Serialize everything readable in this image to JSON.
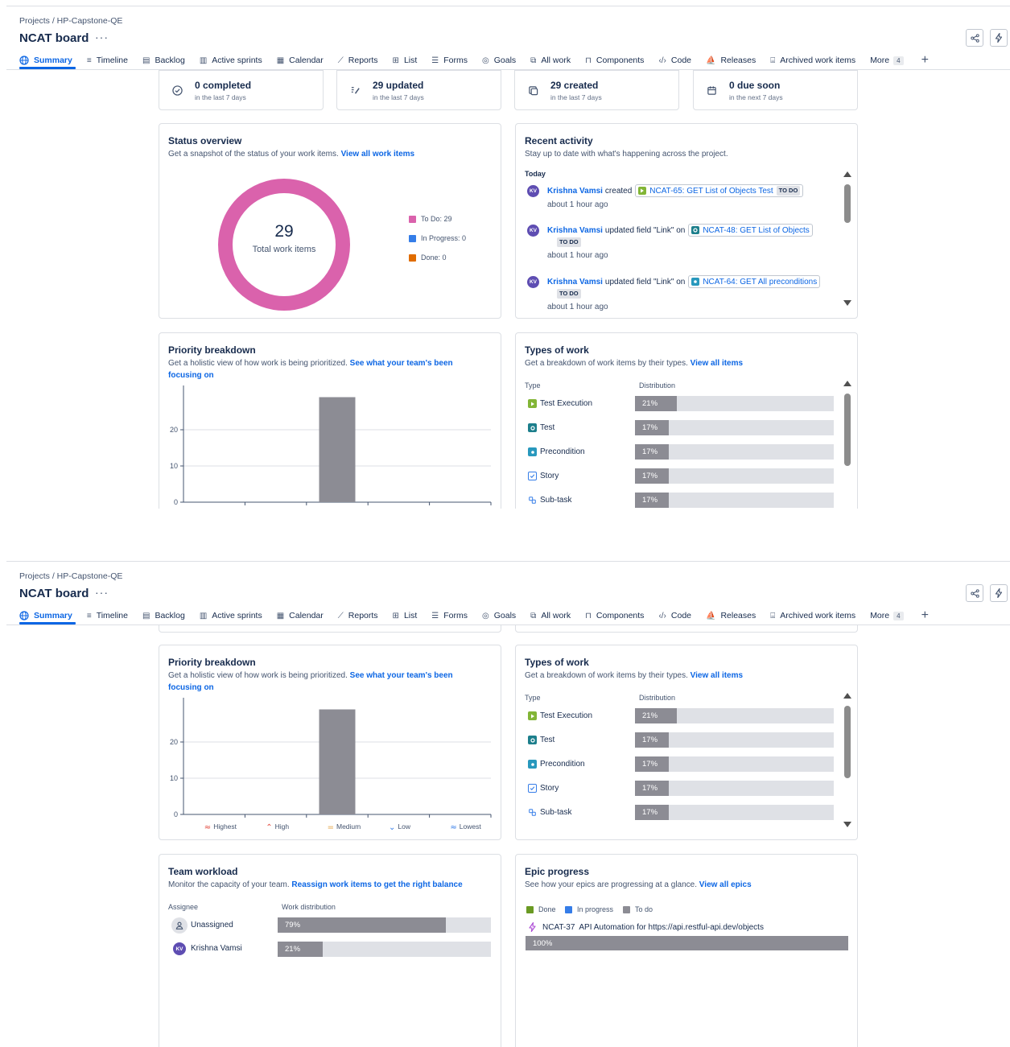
{
  "header": {
    "breadcrumb": "Projects  /  HP-Capstone-QE",
    "title": "NCAT board",
    "more": "···"
  },
  "tabs": [
    {
      "label": "Summary",
      "icon": "globe-icon"
    },
    {
      "label": "Timeline",
      "icon": "timeline-icon"
    },
    {
      "label": "Backlog",
      "icon": "backlog-icon"
    },
    {
      "label": "Active sprints",
      "icon": "board-icon"
    },
    {
      "label": "Calendar",
      "icon": "calendar-icon"
    },
    {
      "label": "Reports",
      "icon": "chart-icon"
    },
    {
      "label": "List",
      "icon": "list-icon"
    },
    {
      "label": "Forms",
      "icon": "forms-icon"
    },
    {
      "label": "Goals",
      "icon": "target-icon"
    },
    {
      "label": "All work",
      "icon": "stack-icon"
    },
    {
      "label": "Components",
      "icon": "components-icon"
    },
    {
      "label": "Code",
      "icon": "code-icon"
    },
    {
      "label": "Releases",
      "icon": "ship-icon"
    },
    {
      "label": "Archived work items",
      "icon": "archive-icon"
    }
  ],
  "more_tab": {
    "label": "More",
    "count": "4"
  },
  "stats": [
    {
      "value": "0 completed",
      "sub": "in the last 7 days",
      "icon": "check-circle-icon"
    },
    {
      "value": "29 updated",
      "sub": "in the last 7 days",
      "icon": "edit-icon"
    },
    {
      "value": "29 created",
      "sub": "in the last 7 days",
      "icon": "create-icon"
    },
    {
      "value": "0 due soon",
      "sub": "in the next 7 days",
      "icon": "calendar-icon"
    }
  ],
  "status_overview": {
    "title": "Status overview",
    "desc": "Get a snapshot of the status of your work items.",
    "link": "View all work items",
    "total": "29",
    "total_label": "Total work items",
    "legend": [
      {
        "label": "To Do: 29",
        "color": "#da62ac",
        "value": 29
      },
      {
        "label": "In Progress: 0",
        "color": "#357de8",
        "value": 0
      },
      {
        "label": "Done: 0",
        "color": "#e06c00",
        "value": 0
      }
    ]
  },
  "recent_activity": {
    "title": "Recent activity",
    "desc": "Stay up to date with what's happening across the project.",
    "day": "Today",
    "items": [
      {
        "avatar": "KV",
        "name": "Krishna Vamsi",
        "action": "created",
        "issue": "NCAT-65: GET List of Objects Test",
        "status": "TO DO",
        "time": "about 1 hour ago",
        "icon_color": "#82b536"
      },
      {
        "avatar": "KV",
        "name": "Krishna Vamsi",
        "action": "updated field \"Link\" on",
        "issue": "NCAT-48: GET List of Objects",
        "status": "TO DO",
        "time": "about 1 hour ago",
        "icon_color": "#1d7f8c"
      },
      {
        "avatar": "KV",
        "name": "Krishna Vamsi",
        "action": "updated field \"Link\" on",
        "issue": "NCAT-64: GET All preconditions",
        "status": "TO DO",
        "time": "about 1 hour ago",
        "icon_color": "#2898bd"
      }
    ]
  },
  "priority": {
    "title": "Priority breakdown",
    "desc": "Get a holistic view of how work is being prioritized.",
    "link1": "See what your team's been",
    "link2": "focusing on"
  },
  "types": {
    "title": "Types of work",
    "desc": "Get a breakdown of work items by their types.",
    "link": "View all items",
    "col_type": "Type",
    "col_dist": "Distribution",
    "rows": [
      {
        "label": "Test Execution",
        "pct": "21%",
        "value": 21,
        "icon": "test-execution-icon",
        "color": "#82b536"
      },
      {
        "label": "Test",
        "pct": "17%",
        "value": 17,
        "icon": "test-icon",
        "color": "#1d7f8c"
      },
      {
        "label": "Precondition",
        "pct": "17%",
        "value": 17,
        "icon": "precondition-icon",
        "color": "#2898bd"
      },
      {
        "label": "Story",
        "pct": "17%",
        "value": 17,
        "icon": "story-icon",
        "color": "#357de8"
      },
      {
        "label": "Sub-task",
        "pct": "17%",
        "value": 17,
        "icon": "subtask-icon",
        "color": "#357de8"
      }
    ]
  },
  "team": {
    "title": "Team workload",
    "desc": "Monitor the capacity of your team.",
    "link": "Reassign work items to get the right balance",
    "col_assignee": "Assignee",
    "col_dist": "Work distribution",
    "rows": [
      {
        "name": "Unassigned",
        "pct": "79%",
        "value": 79,
        "avatar": ""
      },
      {
        "name": "Krishna Vamsi",
        "pct": "21%",
        "value": 21,
        "avatar": "KV"
      }
    ]
  },
  "epic": {
    "title": "Epic progress",
    "desc": "See how your epics are progressing at a glance.",
    "link": "View all epics",
    "legend": [
      {
        "label": "Done",
        "color": "#6a9a23"
      },
      {
        "label": "In progress",
        "color": "#357de8"
      },
      {
        "label": "To do",
        "color": "#8c8c94"
      }
    ],
    "epic_key": "NCAT-37",
    "epic_name": "API Automation for https://api.restful-api.dev/objects",
    "epic_pct": "100%",
    "epic_value": 100
  },
  "chart_data": {
    "type": "bar",
    "categories": [
      "Highest",
      "High",
      "Medium",
      "Low",
      "Lowest"
    ],
    "values": [
      0,
      0,
      29,
      0,
      0
    ],
    "title": "Priority breakdown",
    "xlabel": "",
    "ylabel": "",
    "yticks": [
      "0",
      "10",
      "20"
    ],
    "ylim": [
      0,
      30
    ],
    "grid": true,
    "bar_color": "#8c8c94"
  }
}
